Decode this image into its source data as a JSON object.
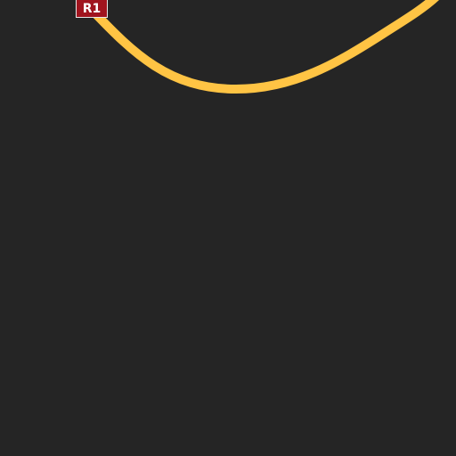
{
  "map": {
    "background_color": "#252525",
    "road": {
      "color": "#ffc444",
      "route_label": "R1",
      "shield_color": "#a0141e"
    }
  }
}
